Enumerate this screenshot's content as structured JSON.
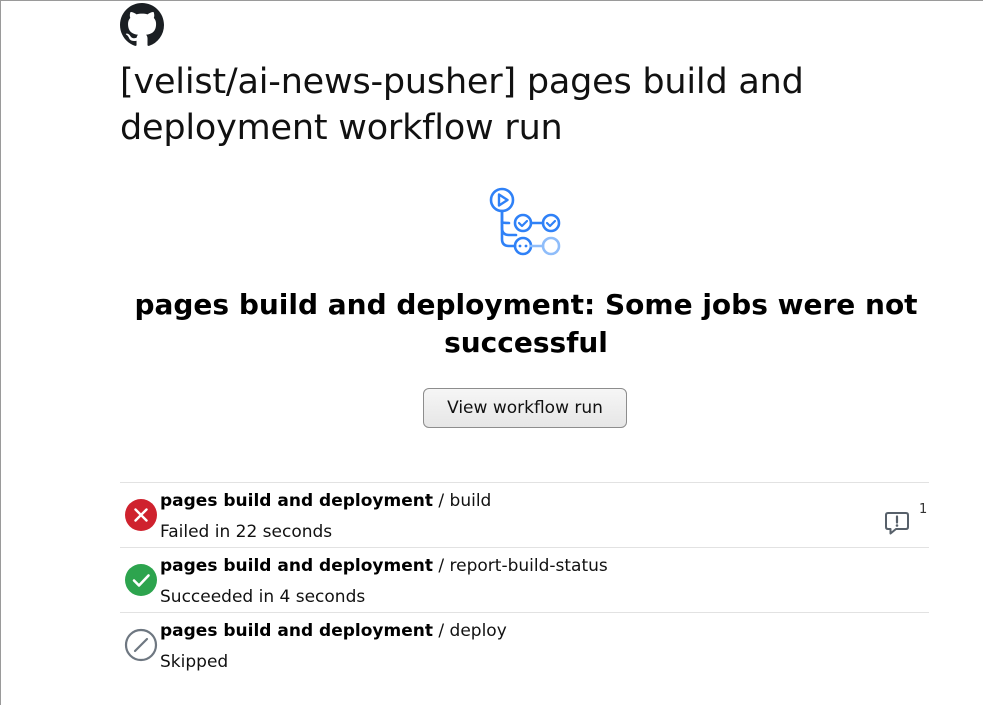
{
  "email": {
    "title": "[velist/ai-news-pusher] pages build and deployment workflow run",
    "logo_icon": "github-octocat-icon",
    "workflow_icon": "workflow-run-icon",
    "headline": "pages build and deployment: Some jobs were not successful",
    "view_button_label": "View workflow run"
  },
  "jobs": [
    {
      "workflow": "pages build and deployment",
      "separator": "/",
      "job": "build",
      "status_text": "Failed in 22 seconds",
      "status": "failed",
      "status_icon": "x-circle-icon",
      "status_color": "#cf222e",
      "annotation_icon": "comment-alert-icon",
      "annotation_count": "1"
    },
    {
      "workflow": "pages build and deployment",
      "separator": "/",
      "job": "report-build-status",
      "status_text": "Succeeded in 4 seconds",
      "status": "success",
      "status_icon": "check-circle-icon",
      "status_color": "#2da44e"
    },
    {
      "workflow": "pages build and deployment",
      "separator": "/",
      "job": "deploy",
      "status_text": "Skipped",
      "status": "skipped",
      "status_icon": "skip-circle-icon",
      "status_color": "#6e7781"
    }
  ]
}
